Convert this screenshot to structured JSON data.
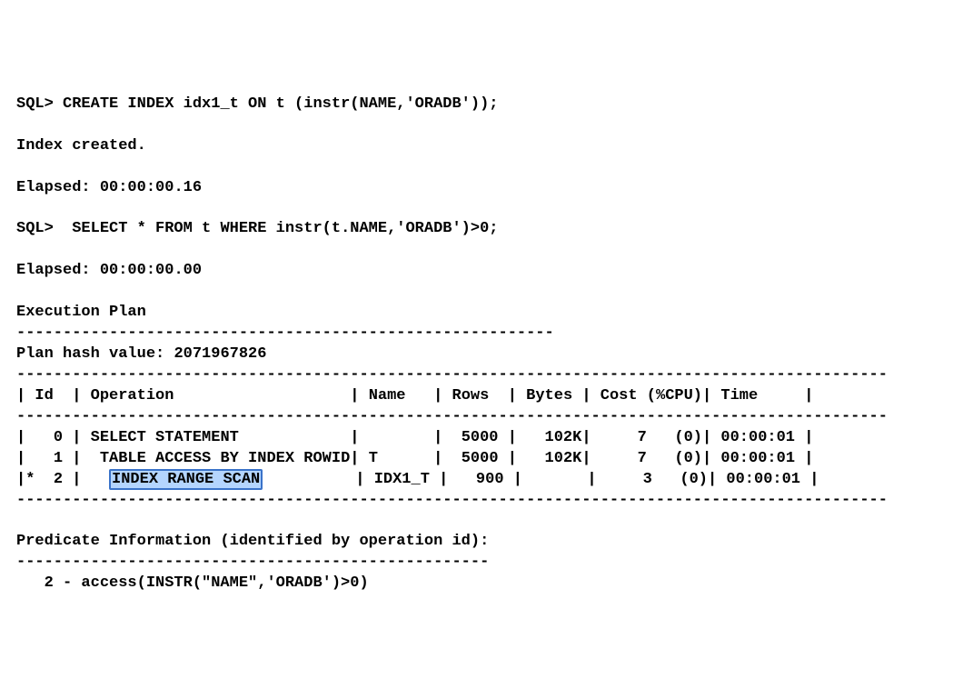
{
  "sql": {
    "prompt": "SQL>",
    "create_index": "CREATE INDEX idx1_t ON t (instr(NAME,'ORADB'));",
    "index_created": "Index created.",
    "elapsed1_label": "Elapsed:",
    "elapsed1_value": "00:00:00.16",
    "select": " SELECT * FROM t WHERE instr(t.NAME,'ORADB')>0;",
    "elapsed2_label": "Elapsed:",
    "elapsed2_value": "00:00:00.00",
    "exec_plan_label": "Execution Plan",
    "dash_short": "----------------------------------------------------------",
    "plan_hash_label": "Plan hash value:",
    "plan_hash_value": "2071967826",
    "dash_long": "----------------------------------------------------------------------------------------------"
  },
  "plan": {
    "header": {
      "id": "Id",
      "operation": "Operation",
      "name": "Name",
      "rows": "Rows",
      "bytes": "Bytes",
      "cost": "Cost (%CPU)",
      "time": "Time"
    },
    "rows": [
      {
        "marker": " ",
        "id": "0",
        "op": "SELECT STATEMENT",
        "name": "",
        "rows": "5000",
        "bytes": "102K",
        "cost": "7",
        "cpu": "(0)",
        "time": "00:00:01"
      },
      {
        "marker": " ",
        "id": "1",
        "op": " TABLE ACCESS BY INDEX ROWID",
        "name": "T",
        "rows": "5000",
        "bytes": "102K",
        "cost": "7",
        "cpu": "(0)",
        "time": "00:00:01"
      },
      {
        "marker": "*",
        "id": "2",
        "op_prefix": "  ",
        "op_highlight": "INDEX RANGE SCAN",
        "op_suffix": "",
        "name": "IDX1_T",
        "rows": "900",
        "bytes": "",
        "cost": "3",
        "cpu": "(0)",
        "time": "00:00:01"
      }
    ]
  },
  "predicate": {
    "label": "Predicate Information (identified by operation id):",
    "dash": "---------------------------------------------------",
    "line": "   2 - access(INSTR(\"NAME\",'ORADB')>0)"
  }
}
